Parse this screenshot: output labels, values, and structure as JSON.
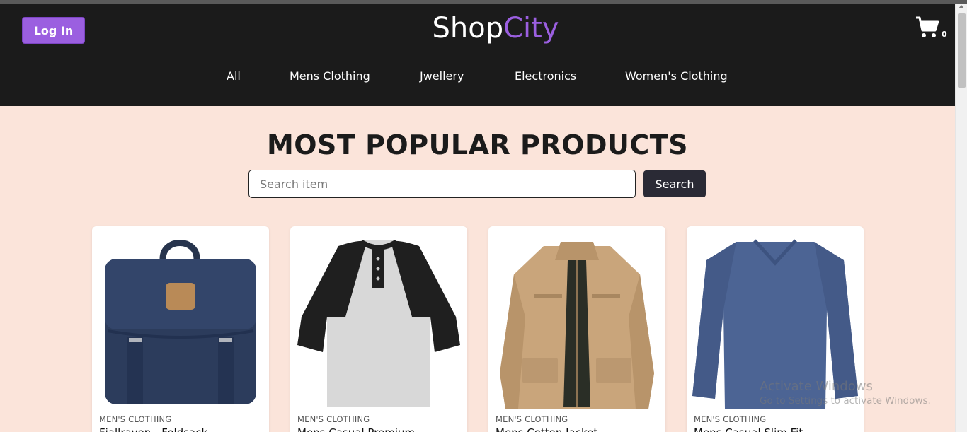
{
  "header": {
    "login_label": "Log In",
    "brand_part1": "Shop",
    "brand_part2": "City",
    "cart_icon": "shopping-cart-icon",
    "cart_count": "0"
  },
  "nav": {
    "items": [
      {
        "label": "All"
      },
      {
        "label": "Mens Clothing"
      },
      {
        "label": "Jwellery"
      },
      {
        "label": "Electronics"
      },
      {
        "label": "Women's Clothing"
      }
    ]
  },
  "main": {
    "title": "MOST POPULAR PRODUCTS",
    "search_placeholder": "Search item",
    "search_value": "",
    "search_button": "Search"
  },
  "products": [
    {
      "category": "MEN'S CLOTHING",
      "name": "Fjallraven - Foldsack",
      "image": "navy-backpack"
    },
    {
      "category": "MEN'S CLOTHING",
      "name": "Mens Casual Premium",
      "image": "raglan-henley-tshirt"
    },
    {
      "category": "MEN'S CLOTHING",
      "name": "Mens Cotton Jacket",
      "image": "khaki-jacket"
    },
    {
      "category": "MEN'S CLOTHING",
      "name": "Mens Casual Slim Fit",
      "image": "blue-long-sleeve-shirt"
    }
  ],
  "watermark": {
    "line1": "Activate Windows",
    "line2": "Go to Settings to activate Windows."
  },
  "colors": {
    "accent": "#9b5fe0",
    "header_bg": "#1b1b1b",
    "page_bg": "#fbe4da",
    "button_dark": "#2a2a35"
  }
}
